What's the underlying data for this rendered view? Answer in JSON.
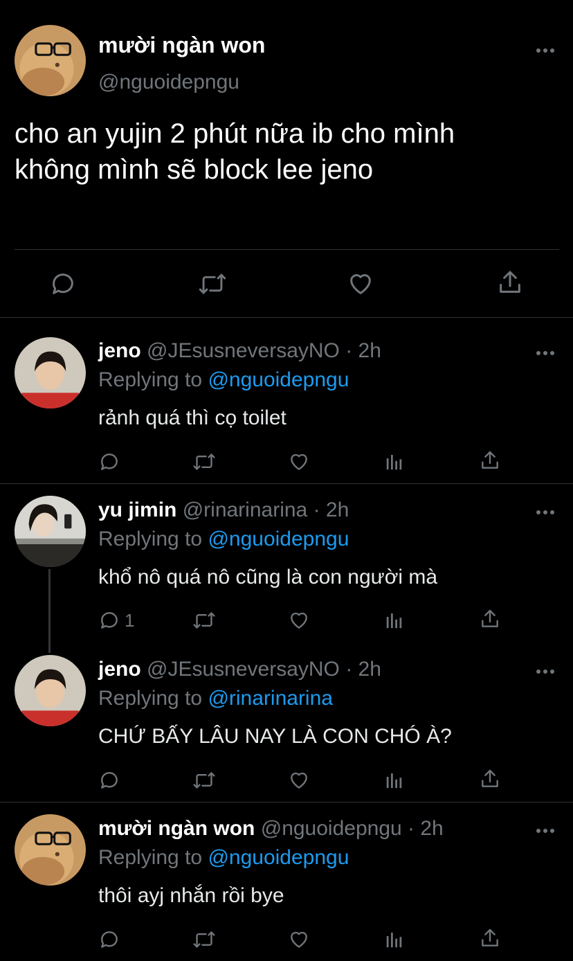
{
  "main_tweet": {
    "display_name": "mười ngàn won",
    "handle": "@nguoidepngu",
    "text_line1": "cho an yujin 2 phút nữa ib cho mình",
    "text_line2": "không mình sẽ block lee jeno"
  },
  "replies": [
    {
      "display_name": "jeno",
      "handle_time": "@JEsusneversayNO · 2h",
      "replying_prefix": "Replying to ",
      "replying_to": "@nguoidepngu",
      "text": "rảnh quá thì cọ toilet",
      "reply_count": ""
    },
    {
      "display_name": "yu jimin",
      "handle_time": "@rinarinarina · 2h",
      "replying_prefix": "Replying to ",
      "replying_to": "@nguoidepngu",
      "text": "khổ nô quá nô cũng là con người mà",
      "reply_count": "1"
    },
    {
      "display_name": "jeno",
      "handle_time": "@JEsusneversayNO · 2h",
      "replying_prefix": "Replying to ",
      "replying_to": "@rinarinarina",
      "text": "CHỨ BẤY LÂU NAY LÀ CON CHÓ À?",
      "reply_count": ""
    },
    {
      "display_name": "mười ngàn won",
      "handle_time": "@nguoidepngu · 2h",
      "replying_prefix": "Replying to ",
      "replying_to": "@nguoidepngu",
      "text": "thôi ayj nhắn rồi bye",
      "reply_count": ""
    }
  ],
  "colors": {
    "background": "#000000",
    "text": "#e7e9ea",
    "muted": "#71767b",
    "link": "#1d9bf0",
    "divider": "#2f3336"
  },
  "icons": [
    "reply-icon",
    "retweet-icon",
    "like-icon",
    "share-icon",
    "analytics-icon",
    "more-icon"
  ]
}
